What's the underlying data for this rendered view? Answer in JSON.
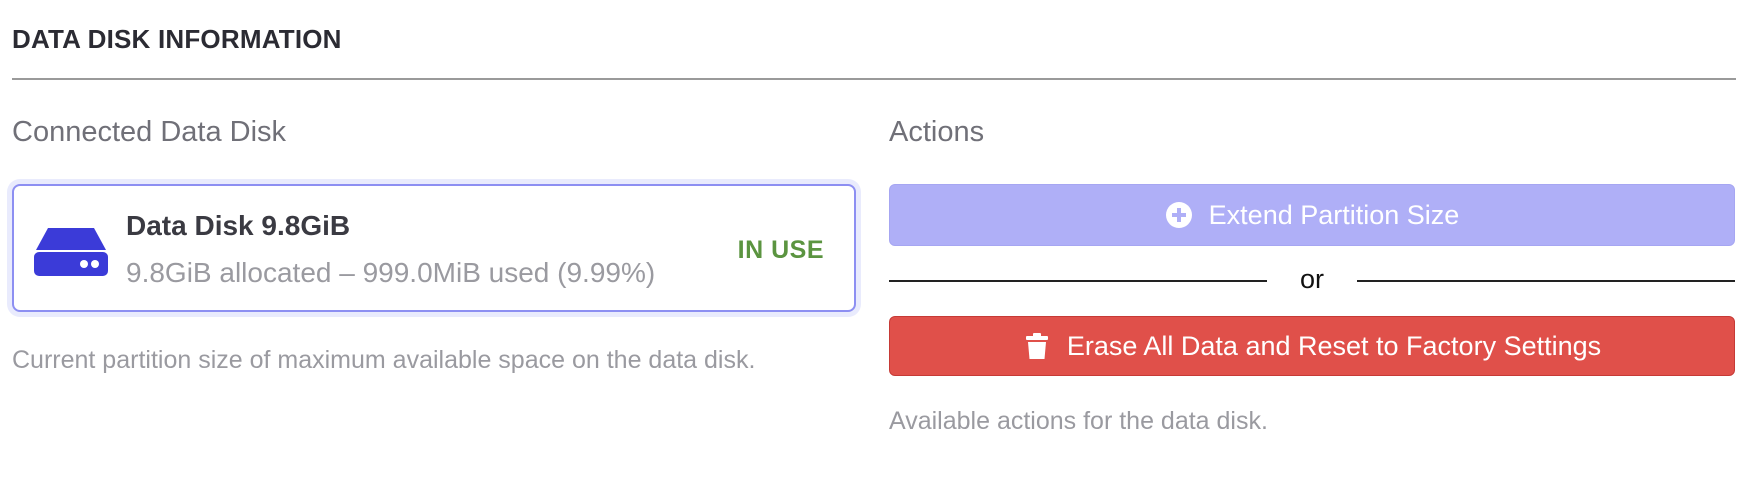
{
  "section": {
    "title": "DATA DISK INFORMATION"
  },
  "connected": {
    "heading": "Connected Data Disk",
    "disk": {
      "icon": "hard-drive-icon",
      "name": "Data Disk 9.8GiB",
      "usage": "9.8GiB allocated – 999.0MiB used (9.99%)",
      "status": "IN USE",
      "status_color": "#5b9440",
      "used_percent": 9.99
    },
    "help": "Current partition size of maximum available space on the data disk."
  },
  "actions": {
    "heading": "Actions",
    "extend_button": {
      "label": "Extend Partition Size",
      "icon": "plus-circle-icon",
      "color": "#afaff7"
    },
    "separator": "or",
    "erase_button": {
      "label": "Erase All Data and Reset to Factory Settings",
      "icon": "trash-icon",
      "color": "#e0504a"
    },
    "help": "Available actions for the data disk."
  },
  "colors": {
    "accent": "#4040d8",
    "card_border": "#8d8ff2"
  }
}
